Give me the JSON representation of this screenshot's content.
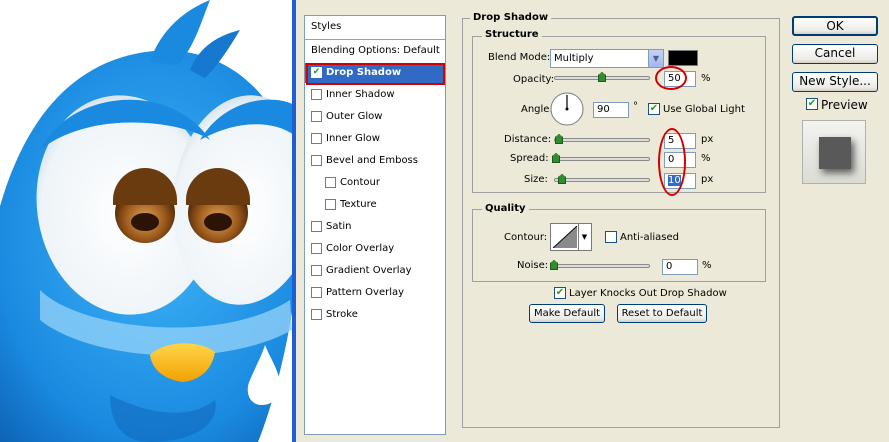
{
  "styles_panel": {
    "header": "Styles",
    "items": [
      {
        "label": "Blending Options: Default",
        "checkable": false,
        "checked": false,
        "indent": 0
      },
      {
        "label": "Drop Shadow",
        "checkable": true,
        "checked": true,
        "indent": 0,
        "active": true
      },
      {
        "label": "Inner Shadow",
        "checkable": true,
        "checked": false,
        "indent": 0
      },
      {
        "label": "Outer Glow",
        "checkable": true,
        "checked": false,
        "indent": 0
      },
      {
        "label": "Inner Glow",
        "checkable": true,
        "checked": false,
        "indent": 0
      },
      {
        "label": "Bevel and Emboss",
        "checkable": true,
        "checked": false,
        "indent": 0
      },
      {
        "label": "Contour",
        "checkable": true,
        "checked": false,
        "indent": 1
      },
      {
        "label": "Texture",
        "checkable": true,
        "checked": false,
        "indent": 1
      },
      {
        "label": "Satin",
        "checkable": true,
        "checked": false,
        "indent": 0
      },
      {
        "label": "Color Overlay",
        "checkable": true,
        "checked": false,
        "indent": 0
      },
      {
        "label": "Gradient Overlay",
        "checkable": true,
        "checked": false,
        "indent": 0
      },
      {
        "label": "Pattern Overlay",
        "checkable": true,
        "checked": false,
        "indent": 0
      },
      {
        "label": "Stroke",
        "checkable": true,
        "checked": false,
        "indent": 0
      }
    ]
  },
  "drop_shadow": {
    "title": "Drop Shadow",
    "structure": {
      "title": "Structure",
      "blend_mode_label": "Blend Mode:",
      "blend_mode_value": "Multiply",
      "shadow_color": "#000000",
      "opacity_label": "Opacity:",
      "opacity_value": "50",
      "opacity_unit": "%",
      "opacity_fraction": 0.5,
      "angle_label": "Angle:",
      "angle_value": "90",
      "angle_unit": "°",
      "use_global_light_label": "Use Global Light",
      "use_global_light_checked": true,
      "distance_label": "Distance:",
      "distance_value": "5",
      "distance_unit": "px",
      "spread_label": "Spread:",
      "spread_value": "0",
      "spread_unit": "%",
      "size_label": "Size:",
      "size_value": "10",
      "size_unit": "px"
    },
    "quality": {
      "title": "Quality",
      "contour_label": "Contour:",
      "anti_aliased_label": "Anti-aliased",
      "anti_aliased_checked": false,
      "noise_label": "Noise:",
      "noise_value": "0",
      "noise_unit": "%"
    },
    "layer_knocks_out_label": "Layer Knocks Out Drop Shadow",
    "layer_knocks_out_checked": true,
    "make_default_label": "Make Default",
    "reset_to_default_label": "Reset to Default"
  },
  "buttons": {
    "ok": "OK",
    "cancel": "Cancel",
    "new_style": "New Style...",
    "preview_label": "Preview",
    "preview_checked": true
  },
  "colors": {
    "dialog_bg": "#ece9d8",
    "selection": "#316ac5",
    "annotation_red": "#d40000",
    "bird_blue": "#1a8ae0"
  }
}
